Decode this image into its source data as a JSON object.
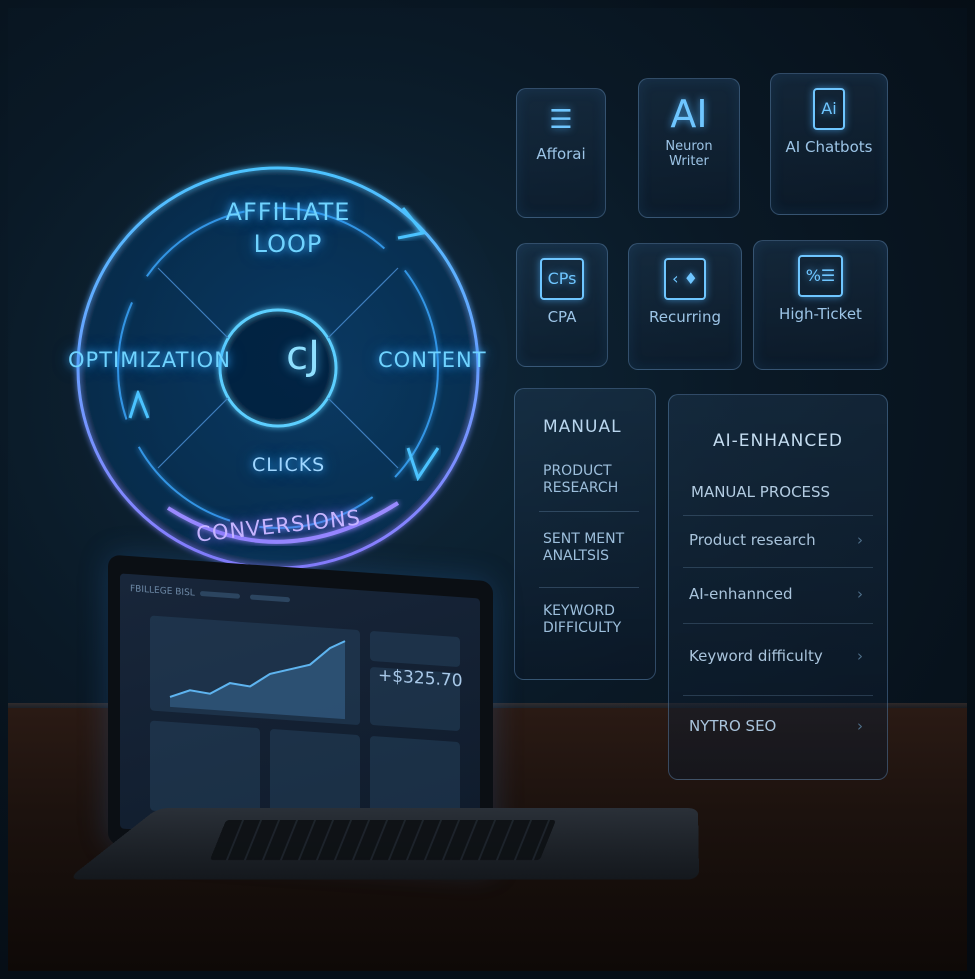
{
  "loop": {
    "title_line1": "AFFILIATE",
    "title_line2": "LOOP",
    "stage_left": "OPTIMIZATION",
    "stage_right": "CONTENT",
    "stage_inner": "CLICKS",
    "stage_bottom": "CONVERSIONS",
    "center_logo": "cJ"
  },
  "tools": [
    {
      "label": "Afforai",
      "icon": "stack-icon"
    },
    {
      "label_line1": "Neuron",
      "label_line2": "Writer",
      "icon_text": "AI"
    },
    {
      "label": "AI Chatbots",
      "icon_text": "Ai"
    },
    {
      "label": "CPA",
      "icon_text": "CPs"
    },
    {
      "label": "Recurring",
      "icon": "shield-icon"
    },
    {
      "label": "High-Ticket",
      "icon": "percent-list-icon"
    }
  ],
  "manual_panel": {
    "heading": "MANUAL",
    "items": [
      "PRODUCT RESEARCH",
      "SENT MENT ANALTSIS",
      "KEYWORD DIFFICULTY"
    ]
  },
  "ai_panel": {
    "heading": "AI-ENHANCED",
    "subheading": "MANUAL PROCESS",
    "rows": [
      "Product research",
      "AI-enhannced",
      "Keyword difficulty",
      "NYTRO SEO"
    ]
  },
  "laptop": {
    "header_text": "FBILLEGE BISL",
    "revenue": "+$325.70"
  }
}
